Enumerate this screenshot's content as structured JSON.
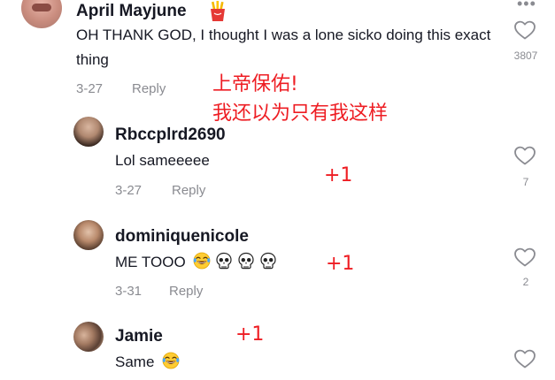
{
  "comments": [
    {
      "username": "April Mayjune",
      "badge_icon": "fries-icon",
      "text": "OH THANK GOD, I thought I was a lone sicko doing this exact thing",
      "date": "3-27",
      "reply_label": "Reply",
      "like_count": "3807",
      "more_icon": "ellipsis-icon"
    },
    {
      "username": "Rbccplrd2690",
      "text": "Lol sameeeee",
      "date": "3-27",
      "reply_label": "Reply",
      "like_count": "7"
    },
    {
      "username": "dominiquenicole",
      "text": "ME TOOO",
      "emojis": [
        "laughing-tears-emoji",
        "skull-emoji",
        "skull-emoji",
        "skull-emoji"
      ],
      "date": "3-31",
      "reply_label": "Reply",
      "like_count": "2"
    },
    {
      "username": "Jamie",
      "text": "Same",
      "emojis": [
        "laughing-tears-emoji"
      ]
    }
  ],
  "annotations": {
    "main_line1": "上帝保佑!",
    "main_line2": "我还以为只有我这样",
    "plus_one": "+1"
  },
  "colors": {
    "annotation": "#ee1d23",
    "muted_text": "#8a8b91",
    "primary_text": "#161823"
  }
}
